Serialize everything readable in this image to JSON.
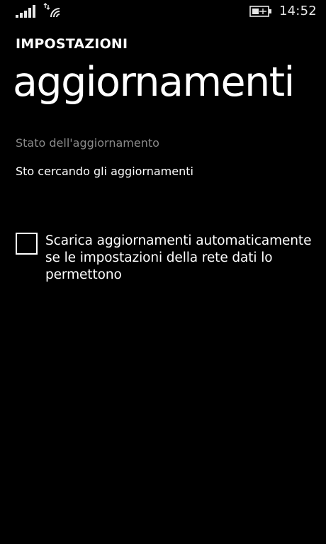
{
  "status_bar": {
    "time": "14:52",
    "icons": [
      "signal-strength-icon",
      "data-connection-icon",
      "battery-charging-icon"
    ]
  },
  "header": {
    "app_title": "IMPOSTAZIONI",
    "page_title": "aggiornamenti"
  },
  "update": {
    "section_label": "Stato dell'aggiornamento",
    "status": "Sto cercando gli aggiornamenti"
  },
  "auto_download": {
    "label": "Scarica aggiornamenti automaticamente se le impostazioni della rete dati lo permettono",
    "checked": false
  },
  "colors": {
    "background": "#000000",
    "text": "#ffffff",
    "subtle_text": "#8a8a8a"
  }
}
